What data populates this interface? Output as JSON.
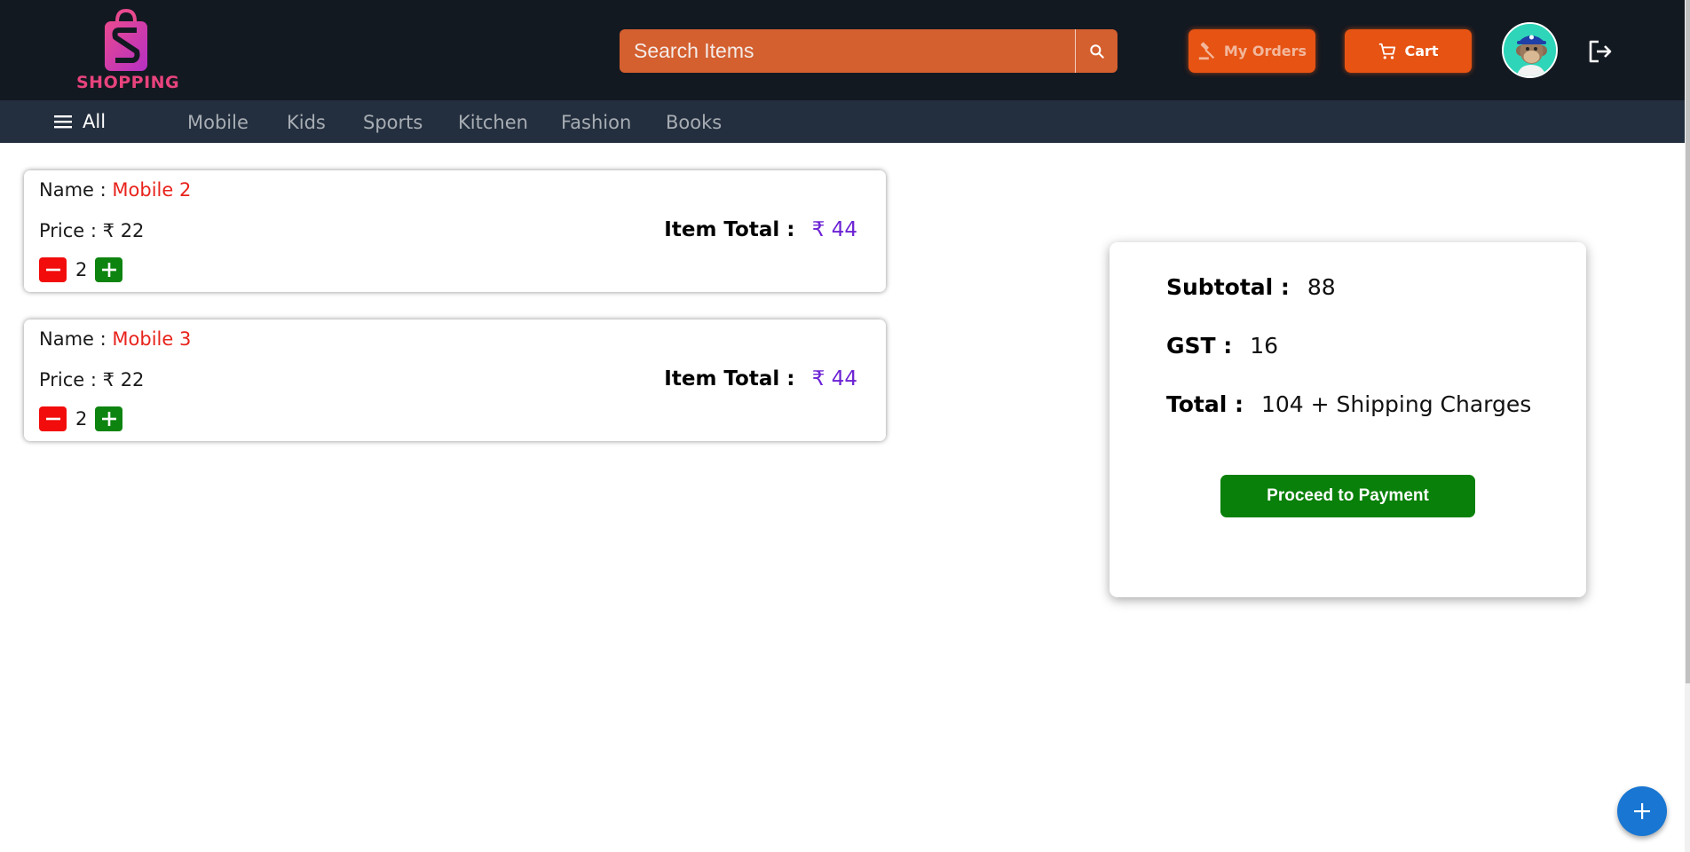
{
  "header": {
    "logo_text": "SHOPPING",
    "search": {
      "placeholder": "Search Items",
      "value": ""
    },
    "my_orders_label": "My Orders",
    "cart_label": "Cart"
  },
  "categories": {
    "all_label": "All",
    "items": [
      "Mobile",
      "Kids",
      "Sports",
      "Kitchen",
      "Fashion",
      "Books"
    ]
  },
  "cart_items": [
    {
      "name_label": "Name :",
      "name": "Mobile 2",
      "price_label": "Price : ₹ 22",
      "total_label": "Item Total :",
      "total": "₹ 44",
      "quantity": "2"
    },
    {
      "name_label": "Name :",
      "name": "Mobile 3",
      "price_label": "Price : ₹ 22",
      "total_label": "Item Total :",
      "total": "₹ 44",
      "quantity": "2"
    }
  ],
  "summary": {
    "subtotal_label": "Subtotal :",
    "subtotal": "88",
    "gst_label": "GST :",
    "gst": "16",
    "total_label": "Total :",
    "total": "104 + Shipping Charges",
    "pay_button": "Proceed to Payment"
  },
  "colors": {
    "header_bg": "#131921",
    "nav_bg": "#232f3e",
    "accent_orange": "#e65313",
    "item_name": "#e8231c",
    "item_total": "#6c22d4",
    "pay_green": "#098009"
  },
  "icons": {
    "search": "search-icon",
    "orders": "gavel-icon",
    "cart": "cart-icon",
    "logout": "logout-icon",
    "menu": "menu-icon",
    "fab": "plus-icon"
  }
}
